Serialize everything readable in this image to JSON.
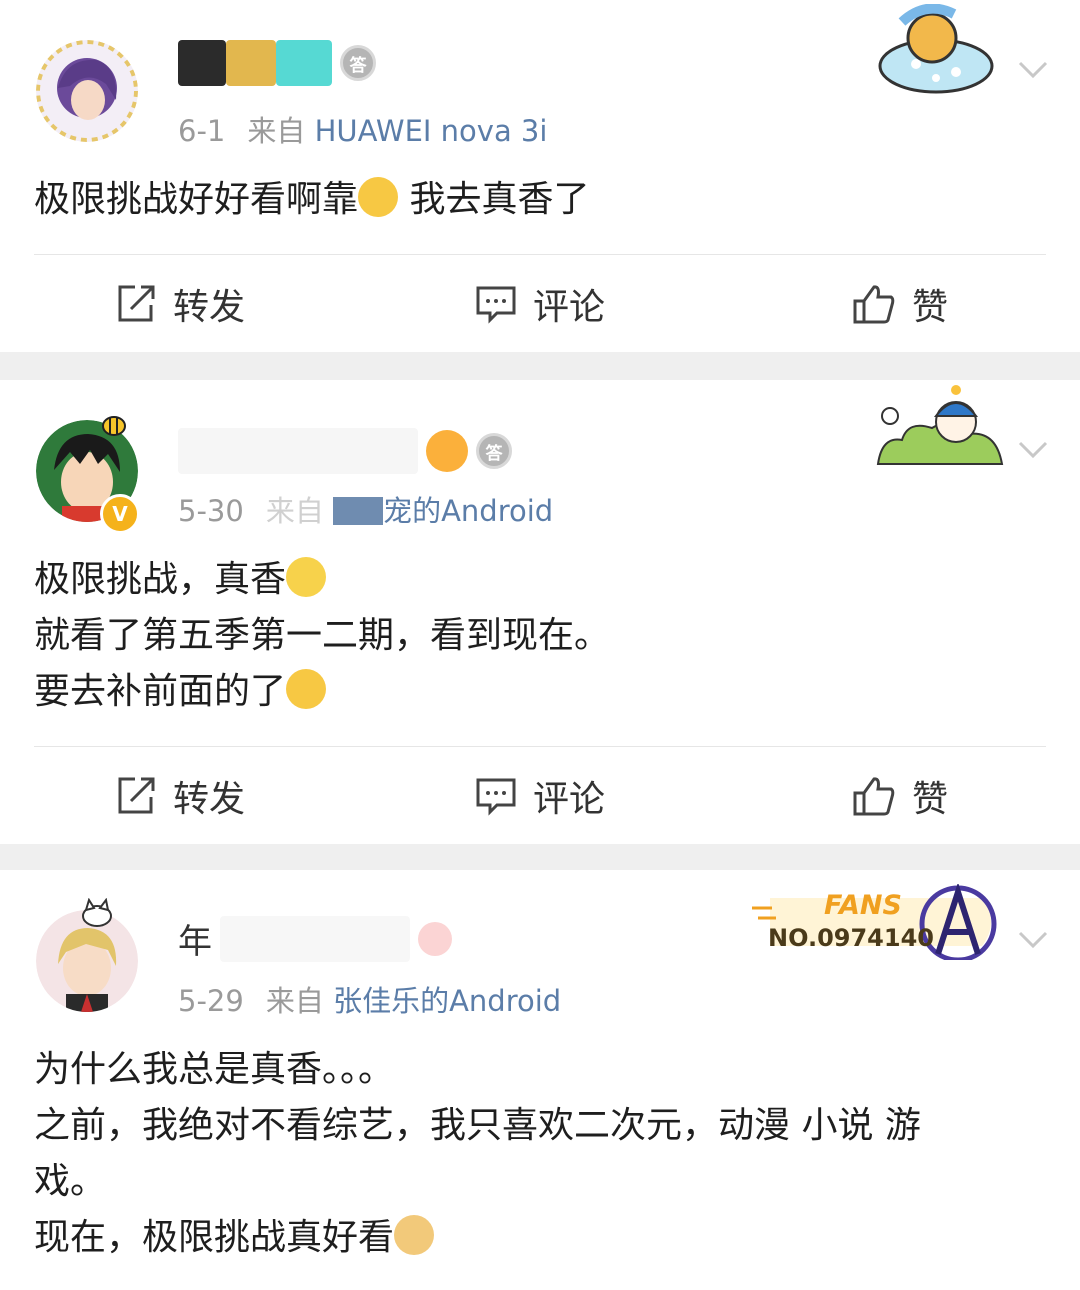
{
  "posts": [
    {
      "date": "6-1",
      "via": "来自",
      "source": "HUAWEI nova 3i",
      "lines": [
        "极限挑战好好看啊靠",
        "我去真香了"
      ],
      "actions": {
        "repost": "转发",
        "comment": "评论",
        "like": "赞"
      },
      "badge": "答"
    },
    {
      "date": "5-30",
      "via": "来自",
      "source": "宠的Android",
      "lines": [
        "极限挑战，真香",
        "就看了第五季第一二期，看到现在。",
        "要去补前面的了"
      ],
      "actions": {
        "repost": "转发",
        "comment": "评论",
        "like": "赞"
      },
      "badge": "答"
    },
    {
      "name_visible": "年",
      "date": "5-29",
      "via": "来自",
      "source": "张佳乐的Android",
      "fans_label": "FANS",
      "fans_no": "NO.0974140",
      "lines": [
        "为什么我总是真香。。。",
        "之前，我绝对不看综艺，我只喜欢二次元，动漫 小说 游",
        "戏。",
        "现在，极限挑战真好看"
      ]
    }
  ],
  "colors": {
    "source_link": "#5b7da8",
    "meta_gray": "#9a9a9a",
    "gap_bg": "#efefef",
    "fans_gold": "#f0a020"
  }
}
